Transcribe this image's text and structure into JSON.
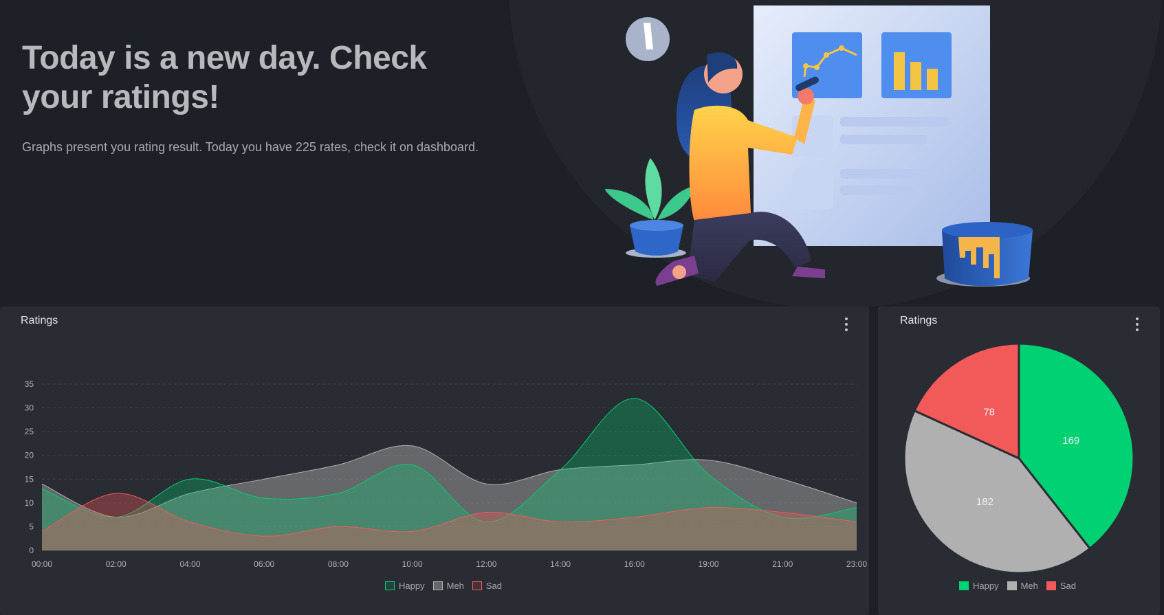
{
  "hero": {
    "title": "Today is a new day. Check your ratings!",
    "text": "Graphs present you rating result. Today you have 225 rates, check it on dashboard."
  },
  "line_card": {
    "title": "Ratings"
  },
  "pie_card": {
    "title": "Ratings"
  },
  "icons": {
    "menu": "vertical-dots-icon"
  },
  "colors": {
    "happy": "#00d173",
    "meh": "#b0b0b0",
    "sad": "#f25a5a",
    "background": "#1e2027",
    "card": "#2a2c33"
  },
  "chart_data": [
    {
      "type": "area",
      "title": "Ratings",
      "categories": [
        "00:00",
        "02:00",
        "04:00",
        "06:00",
        "08:00",
        "10:00",
        "12:00",
        "14:00",
        "16:00",
        "19:00",
        "21:00",
        "23:00"
      ],
      "ylim": [
        0,
        35
      ],
      "yticks": [
        0,
        5,
        10,
        15,
        20,
        25,
        30,
        35
      ],
      "grid": true,
      "legend": "bottom",
      "series": [
        {
          "name": "Happy",
          "color": "#00d173",
          "values": [
            13,
            7,
            15,
            11,
            12,
            18,
            6,
            17,
            32,
            16,
            7,
            9
          ]
        },
        {
          "name": "Meh",
          "color": "#b0b0b0",
          "values": [
            14,
            7,
            12,
            15,
            18,
            22,
            14,
            17,
            18,
            19,
            15,
            10
          ]
        },
        {
          "name": "Sad",
          "color": "#f25a5a",
          "values": [
            4,
            12,
            6,
            3,
            5,
            4,
            8,
            6,
            7,
            9,
            8,
            6
          ]
        }
      ]
    },
    {
      "type": "pie",
      "title": "Ratings",
      "legend": "bottom",
      "categories": [
        "Happy",
        "Meh",
        "Sad"
      ],
      "values": [
        169,
        182,
        78
      ],
      "colors": [
        "#00d173",
        "#b0b0b0",
        "#f25a5a"
      ]
    }
  ]
}
